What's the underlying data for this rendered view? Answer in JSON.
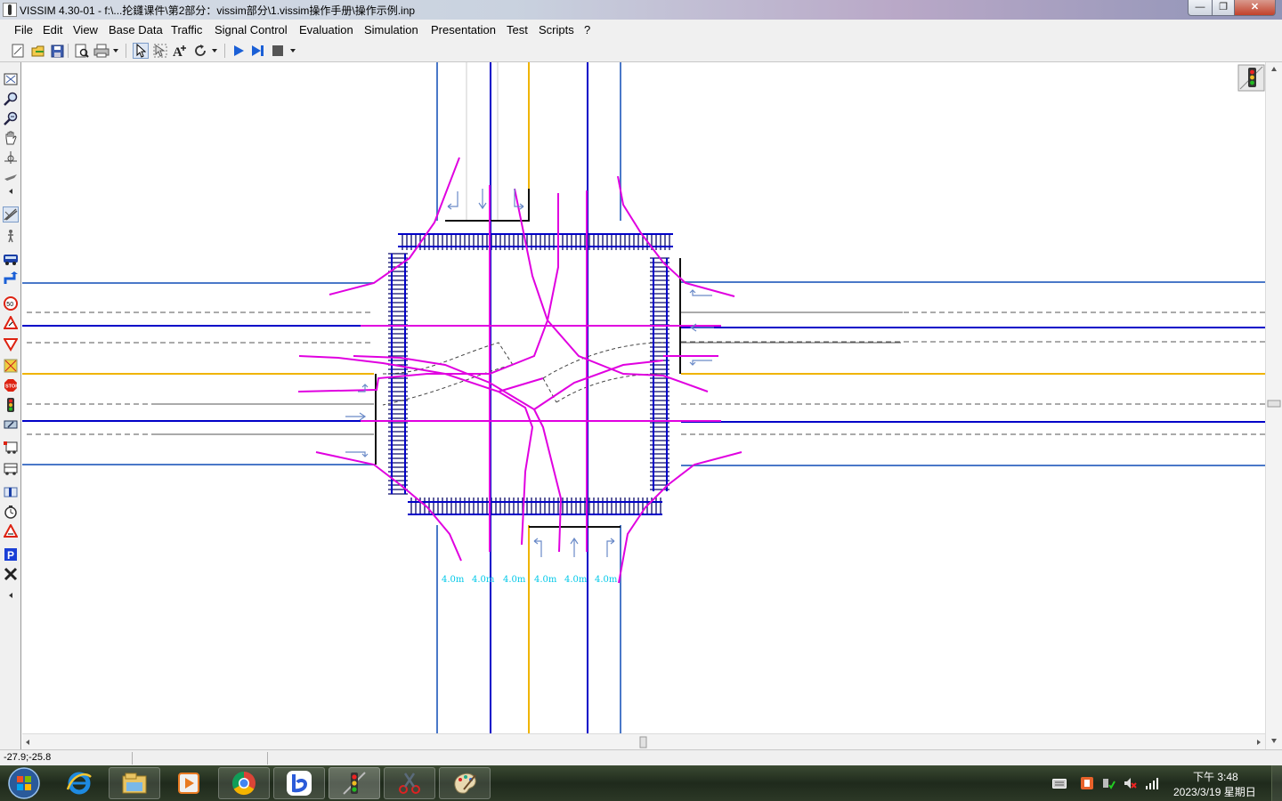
{
  "window": {
    "title": "VISSIM 4.30-01 - f:\\...抡鑝课件\\第2部分：vissim部分\\1.vissim操作手册\\操作示例.inp",
    "minimize": "—",
    "maximize": "❐",
    "close": "✕"
  },
  "menu": [
    {
      "label": "File"
    },
    {
      "label": "Edit"
    },
    {
      "label": "View"
    },
    {
      "label": "Base Data"
    },
    {
      "label": "Traffic"
    },
    {
      "label": "Signal Control"
    },
    {
      "label": "Evaluation"
    },
    {
      "label": "Simulation"
    },
    {
      "label": "Presentation"
    },
    {
      "label": "Test"
    },
    {
      "label": "Scripts"
    },
    {
      "label": "?"
    }
  ],
  "toolbar": [
    "new-file-icon",
    "open-file-icon",
    "save-icon",
    "print-preview-icon",
    "print-icon",
    "select-pointer-icon",
    "multi-select-icon",
    "text-label-icon",
    "rotate-icon",
    "run-simulation-icon",
    "single-step-icon",
    "stop-simulation-icon"
  ],
  "left_toolbar": [
    "zoom-all-icon",
    "zoom-in-icon",
    "zoom-out-icon",
    "pan-hand-icon",
    "rotate-view-icon",
    "links-connectors-icon",
    "pedestrian-icon",
    "vehicle-input-icon",
    "routing-icon",
    "speed-limit-icon",
    "reduced-speed-icon",
    "priority-rule-icon",
    "conflict-area-icon",
    "stop-sign-icon",
    "signal-head-icon",
    "detector-icon",
    "transit-stop-icon",
    "transit-line-icon",
    "node-icon",
    "travel-time-icon",
    "queue-counter-icon",
    "parking-lot-icon",
    "close-network-icon"
  ],
  "canvas": {
    "lane_width_labels": [
      "4.0m",
      "4.0m",
      "4.0m",
      "4.0m",
      "4.0m",
      "4.0m"
    ],
    "colors": {
      "link": "#0000c8",
      "link_edge": "#4a78c8",
      "connector": "#e000e0",
      "median": "#f0b400",
      "lane_label": "#00c8e8"
    }
  },
  "status": {
    "coordinates": "-27.9;-25.8"
  },
  "taskbar": {
    "time": "下午 3:48",
    "date": "2023/3/19 星期日"
  }
}
